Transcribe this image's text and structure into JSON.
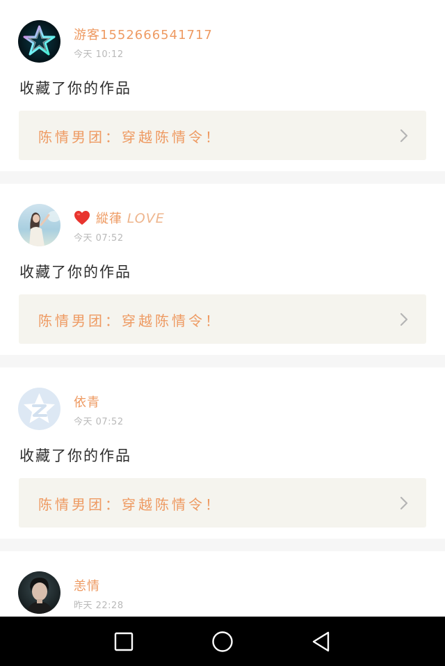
{
  "feed": [
    {
      "avatar_icon": "neon-star-avatar",
      "username": "游客1552666541717",
      "username_suffix": "",
      "badge_icon": "",
      "timestamp": "今天 10:12",
      "message": "收藏了你的作品",
      "work_title": "陈情男团：穿越陈情令！"
    },
    {
      "avatar_icon": "girl-photo-avatar",
      "username": "縱葎",
      "username_suffix": "LOVE",
      "badge_icon": "heart-icon",
      "timestamp": "今天 07:52",
      "message": "收藏了你的作品",
      "work_title": "陈情男团：穿越陈情令！"
    },
    {
      "avatar_icon": "default-z-avatar",
      "username": "依青",
      "username_suffix": "",
      "badge_icon": "",
      "timestamp": "今天 07:52",
      "message": "收藏了你的作品",
      "work_title": "陈情男团：穿越陈情令！"
    },
    {
      "avatar_icon": "man-photo-avatar",
      "username": "恙情",
      "username_suffix": "",
      "badge_icon": "",
      "timestamp": "昨天 22:28",
      "message": "",
      "work_title": ""
    }
  ],
  "navbar": {
    "buttons": [
      "recents-square-icon",
      "home-circle-icon",
      "back-triangle-icon"
    ]
  },
  "colors": {
    "accent": "#ee9a62",
    "timestamp": "#b9b9b9",
    "link_bg": "#f5f4ee",
    "divider": "#f6f6f6",
    "navbar": "#000000",
    "heart": "#e8342e"
  }
}
